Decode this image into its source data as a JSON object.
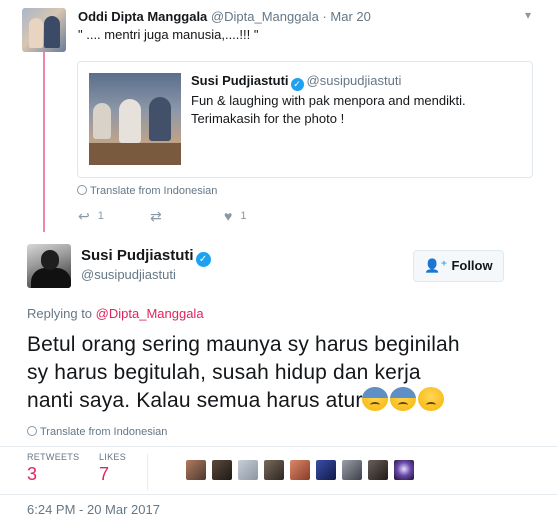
{
  "parent_tweet": {
    "name": "Oddi Dipta Manggala",
    "handle": "@Dipta_Manggala",
    "date": "Mar 20",
    "text": "\" .... mentri juga manusia,....!!! \"",
    "translate_label": "Translate from Indonesian",
    "reply_count": "1",
    "retweet_count": "",
    "like_count": "1",
    "quoted": {
      "name": "Susi Pudjiastuti",
      "handle": "@susipudjiastuti",
      "text_line1": "Fun & laughing with pak menpora and mendikti.",
      "text_line2": "Terimakasih for the photo !"
    }
  },
  "main_tweet": {
    "name": "Susi Pudjiastuti",
    "handle": "@susipudjiastuti",
    "follow_label": "Follow",
    "replying_prefix": "Replying to",
    "replying_to": "@Dipta_Manggala",
    "text_line1": "Betul orang sering maunya sy harus beginilah",
    "text_line2": "sy harus begitulah, susah hidup dan kerja",
    "text_line3": "nanti saya. Kalau semua harus atur",
    "translate_label": "Translate from Indonesian",
    "retweets_label": "RETWEETS",
    "retweets_count": "3",
    "likes_label": "LIKES",
    "likes_count": "7",
    "timestamp": "6:24 PM - 20 Mar 2017"
  },
  "icons": {
    "verified": "verified-badge-icon",
    "caret": "chevron-down-icon",
    "reply": "reply-icon",
    "retweet": "retweet-icon",
    "like": "heart-icon",
    "follow": "add-user-icon",
    "translate": "globe-icon"
  },
  "colors": {
    "accent_blue": "#1da1f2",
    "accent_pink": "#e0245e",
    "muted": "#657786"
  }
}
